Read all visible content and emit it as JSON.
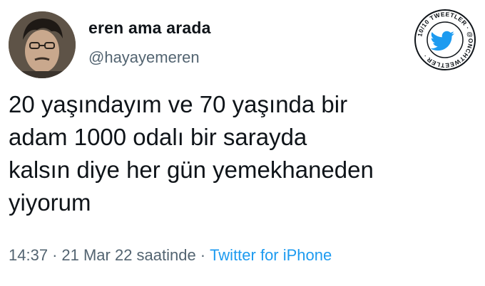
{
  "user": {
    "display_name": "eren ama arada",
    "handle": "@hayayemeren"
  },
  "badge": {
    "ring_text": "10/10 TWEETLER @ONCHTWEETLER",
    "icon": "twitter-bird-icon",
    "accent_color": "#1d9bf0"
  },
  "tweet": {
    "lines": [
      "20 yaşındayım ve 70 yaşında bir",
      "adam 1000 odalı bir sarayda",
      "kalsın diye her gün yemekhaneden",
      "yiyorum"
    ]
  },
  "meta": {
    "time": "14:37",
    "date": "21 Mar 22 saatinde",
    "source": "Twitter for iPhone",
    "separator": "·"
  },
  "colors": {
    "text": "#0f1419",
    "secondary": "#536471",
    "link": "#1d9bf0"
  }
}
